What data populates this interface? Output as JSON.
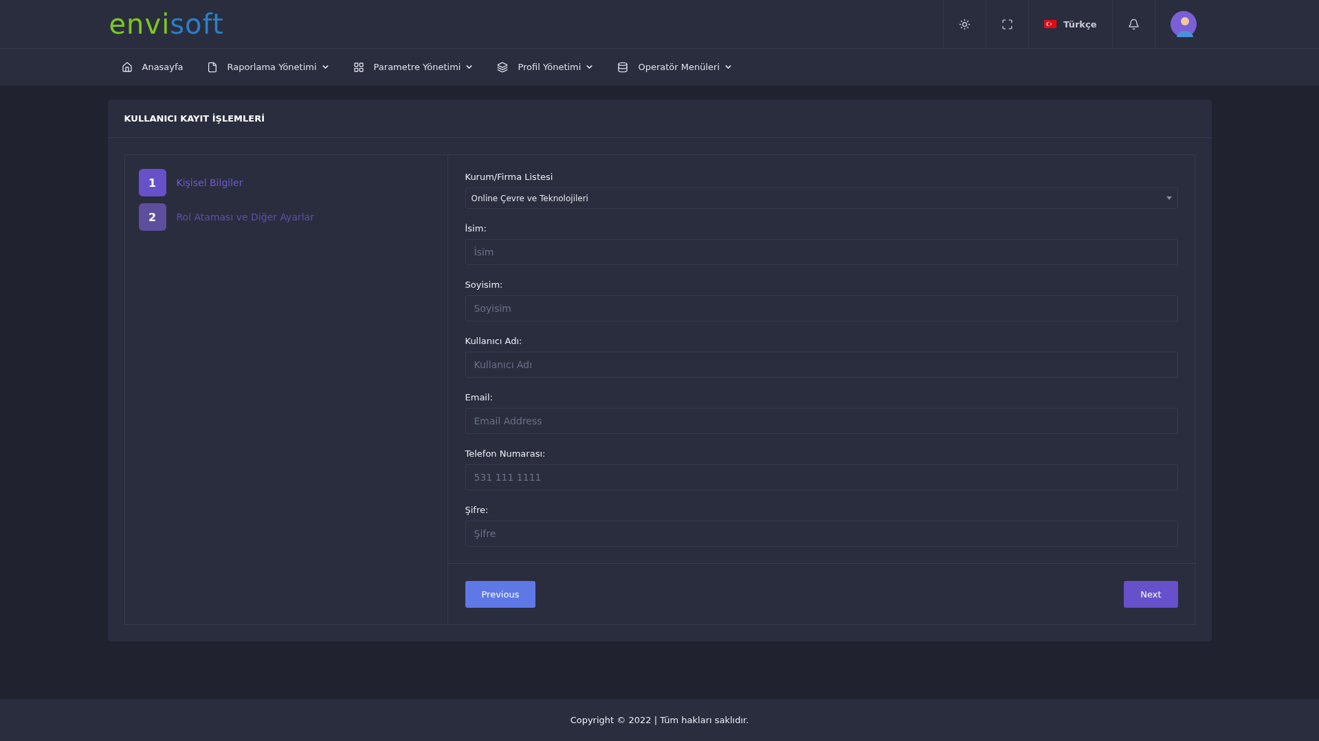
{
  "logo": {
    "parts": [
      {
        "text": "envi",
        "color": "#7cc820"
      },
      {
        "text": "soft",
        "color": "#2b7fc6"
      }
    ]
  },
  "topbar": {
    "language": "Türkçe"
  },
  "nav": [
    {
      "label": "Anasayfa",
      "dropdown": false
    },
    {
      "label": "Raporlama Yönetimi",
      "dropdown": true
    },
    {
      "label": "Parametre Yönetimi",
      "dropdown": true
    },
    {
      "label": "Profil Yönetimi",
      "dropdown": true
    },
    {
      "label": "Operatör Menüleri",
      "dropdown": true
    }
  ],
  "card": {
    "title": "KULLANICI KAYIT İŞLEMLERİ"
  },
  "steps": [
    {
      "number": "1",
      "label": "Kişisel Bilgiler",
      "selected": true
    },
    {
      "number": "2",
      "label": "Rol Ataması ve Diğer Ayarlar",
      "selected": false
    }
  ],
  "fields": [
    {
      "kind": "select",
      "label": "Kurum/Firma Listesi",
      "value": "Online Çevre ve Teknolojileri"
    },
    {
      "kind": "input",
      "label": "İsim:",
      "placeholder": "İsim"
    },
    {
      "kind": "input",
      "label": "Soyisim:",
      "placeholder": "Soyisim"
    },
    {
      "kind": "input",
      "label": "Kullanıcı Adı:",
      "placeholder": "Kullanıcı Adı"
    },
    {
      "kind": "input",
      "label": "Email:",
      "placeholder": "Email Address"
    },
    {
      "kind": "input",
      "label": "Telefon Numarası:",
      "placeholder": "531 111 1111"
    },
    {
      "kind": "input",
      "label": "Şifre:",
      "placeholder": "Şifre"
    }
  ],
  "buttons": {
    "previous": "Previous",
    "next": "Next"
  },
  "footer": "Copyright © 2022 | Tüm hakları saklıdır."
}
